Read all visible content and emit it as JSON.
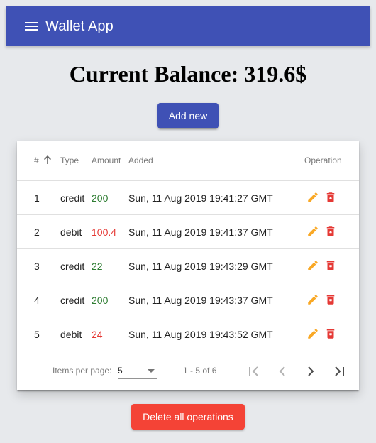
{
  "header": {
    "title": "Wallet App",
    "menu_icon": "menu-icon"
  },
  "balance": {
    "label": "Current Balance: 319.6$"
  },
  "actions": {
    "add_new": "Add new",
    "delete_all": "Delete all operations"
  },
  "colors": {
    "primary": "#3f51b5",
    "warn": "#f44336",
    "credit": "#2e7d32",
    "debit": "#e53935",
    "edit_icon": "#f9a825",
    "delete_icon": "#e53935"
  },
  "table": {
    "columns": {
      "index": "#",
      "type": "Type",
      "amount": "Amount",
      "added": "Added",
      "operation": "Operation"
    },
    "sort": {
      "column": "index",
      "direction": "ascending",
      "icon": "arrow-up-icon"
    },
    "rows": [
      {
        "index": "1",
        "type": "credit",
        "amount": "200",
        "added": "Sun, 11 Aug 2019 19:41:27 GMT"
      },
      {
        "index": "2",
        "type": "debit",
        "amount": "100.4",
        "added": "Sun, 11 Aug 2019 19:41:37 GMT"
      },
      {
        "index": "3",
        "type": "credit",
        "amount": "22",
        "added": "Sun, 11 Aug 2019 19:43:29 GMT"
      },
      {
        "index": "4",
        "type": "credit",
        "amount": "200",
        "added": "Sun, 11 Aug 2019 19:43:37 GMT"
      },
      {
        "index": "5",
        "type": "debit",
        "amount": "24",
        "added": "Sun, 11 Aug 2019 19:43:52 GMT"
      }
    ],
    "row_icons": {
      "edit": "pencil-icon",
      "delete": "trash-icon"
    }
  },
  "paginator": {
    "items_per_page_label": "Items per page:",
    "items_per_page_value": "5",
    "range_label": "1 - 5 of 6",
    "icons": [
      "first-page-icon",
      "previous-page-icon",
      "next-page-icon",
      "last-page-icon"
    ]
  }
}
